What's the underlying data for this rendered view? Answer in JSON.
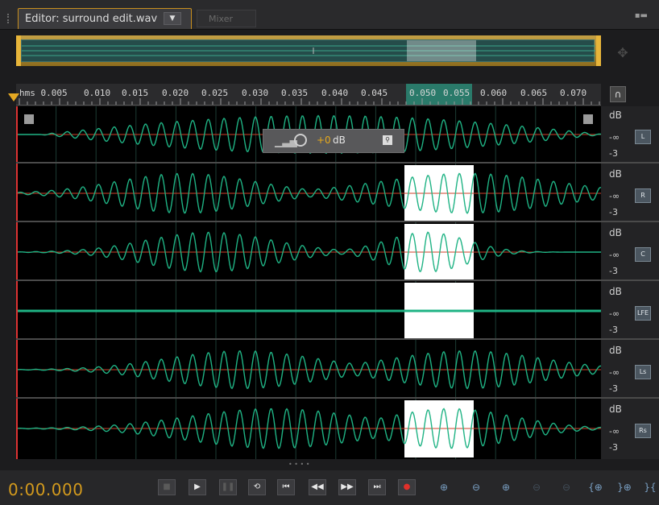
{
  "tabs": {
    "editor_label": "Editor: surround edit.wav",
    "dropdown_glyph": "▼",
    "mixer_label": "Mixer",
    "panel_menu_glyph": "▪▬"
  },
  "ruler": {
    "labels": [
      "hms 0.005",
      "0.010",
      "0.015",
      "0.020",
      "0.025",
      "0.030",
      "0.035",
      "0.040",
      "0.045",
      "0.050",
      "0.055",
      "0.060",
      "0.065",
      "0.070"
    ]
  },
  "hud": {
    "value": "+0",
    "unit": "dB"
  },
  "channels": [
    {
      "name": "L",
      "db": "dB",
      "inf": "-∞",
      "minus3": "-3"
    },
    {
      "name": "R",
      "db": "dB",
      "inf": "-∞",
      "minus3": "-3"
    },
    {
      "name": "C",
      "db": "dB",
      "inf": "-∞",
      "minus3": "-3"
    },
    {
      "name": "LFE",
      "db": "dB",
      "inf": "-∞",
      "minus3": "-3"
    },
    {
      "name": "Ls",
      "db": "dB",
      "inf": "-∞",
      "minus3": "-3"
    },
    {
      "name": "Rs",
      "db": "dB",
      "inf": "-∞",
      "minus3": "-3"
    }
  ],
  "transport": {
    "time": "0:00.000",
    "buttons": [
      {
        "name": "stop",
        "glyph": "■",
        "dim": true
      },
      {
        "name": "play",
        "glyph": "▶",
        "dim": false
      },
      {
        "name": "pause",
        "glyph": "❚❚",
        "dim": true
      },
      {
        "name": "loop",
        "glyph": "⟲",
        "dim": false
      },
      {
        "name": "go-to-start",
        "glyph": "⏮",
        "dim": false
      },
      {
        "name": "rewind",
        "glyph": "◀◀",
        "dim": false
      },
      {
        "name": "fast-forward",
        "glyph": "▶▶",
        "dim": false
      },
      {
        "name": "go-to-end",
        "glyph": "⏭",
        "dim": false
      },
      {
        "name": "record",
        "glyph": "●",
        "dim": false
      }
    ],
    "zoom_buttons": [
      {
        "name": "zoom-in-amplitude",
        "glyph": "⊕",
        "dim": false
      },
      {
        "name": "zoom-out-amplitude",
        "glyph": "⊖",
        "dim": false
      },
      {
        "name": "zoom-in-time",
        "glyph": "⊕",
        "dim": false
      },
      {
        "name": "zoom-out-time",
        "glyph": "⊖",
        "dim": true
      },
      {
        "name": "zoom-out-full",
        "glyph": "⊖",
        "dim": true
      },
      {
        "name": "zoom-in-at-start",
        "glyph": "{⊕",
        "dim": false
      },
      {
        "name": "zoom-in-at-end",
        "glyph": "}⊕",
        "dim": false
      },
      {
        "name": "zoom-to-selection",
        "glyph": "}{",
        "dim": false
      }
    ]
  },
  "colors": {
    "accent": "#d39a1d",
    "waveform": "#1fb384",
    "selection": "#ffffff",
    "centerline": "#d0402a"
  }
}
